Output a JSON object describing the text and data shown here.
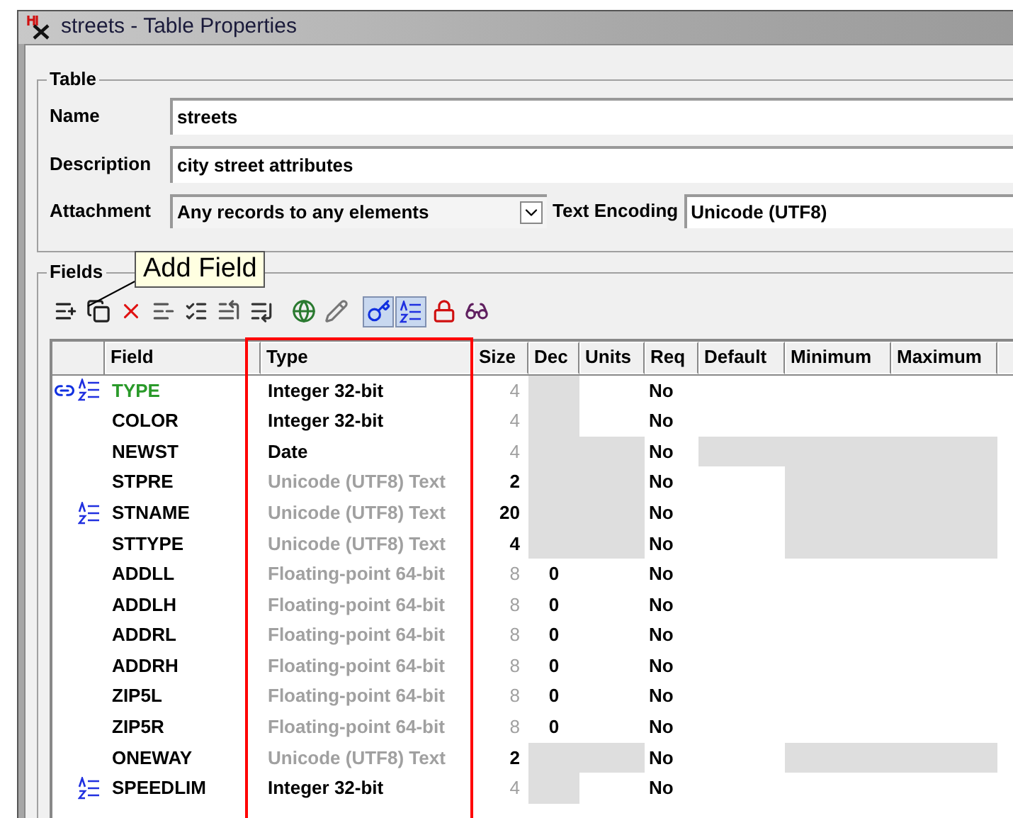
{
  "window": {
    "title": "streets - Table Properties"
  },
  "table_group": {
    "label": "Table",
    "name_label": "Name",
    "name": "streets",
    "description_label": "Description",
    "description": "city street attributes",
    "attachment_label": "Attachment",
    "attachment": "Any records to any elements",
    "encoding_label": "Text Encoding",
    "encoding": "Unicode (UTF8)"
  },
  "fields_group": {
    "label": "Fields",
    "tooltip": "Add Field",
    "toolbar": {
      "show_keys": true,
      "show_indexes": true
    },
    "columns": [
      "Field",
      "Type",
      "Size",
      "Dec",
      "Units",
      "Req",
      "Default",
      "Minimum",
      "Maximum"
    ],
    "rows": [
      {
        "field": "TYPE",
        "primary": true,
        "key": true,
        "indexed": true,
        "type": "Integer 32-bit",
        "type_dimmed": false,
        "size": "4",
        "size_dimmed": true,
        "dec_disabled": true,
        "units_disabled": false,
        "req": "No",
        "default_disabled": false,
        "limits_disabled": false
      },
      {
        "field": "COLOR",
        "primary": false,
        "key": false,
        "indexed": false,
        "type": "Integer 32-bit",
        "type_dimmed": false,
        "size": "4",
        "size_dimmed": true,
        "dec_disabled": true,
        "units_disabled": false,
        "req": "No",
        "default_disabled": false,
        "limits_disabled": false
      },
      {
        "field": "NEWST",
        "primary": false,
        "key": false,
        "indexed": false,
        "type": "Date",
        "type_dimmed": false,
        "size": "4",
        "size_dimmed": true,
        "dec_disabled": true,
        "units_disabled": true,
        "req": "No",
        "default_disabled": true,
        "limits_disabled": true
      },
      {
        "field": "STPRE",
        "primary": false,
        "key": false,
        "indexed": false,
        "type": "Unicode (UTF8) Text",
        "type_dimmed": true,
        "size": "2",
        "size_dimmed": false,
        "dec_disabled": true,
        "units_disabled": true,
        "req": "No",
        "default_disabled": false,
        "limits_disabled": true
      },
      {
        "field": "STNAME",
        "primary": false,
        "key": false,
        "indexed": true,
        "type": "Unicode (UTF8) Text",
        "type_dimmed": true,
        "size": "20",
        "size_dimmed": false,
        "dec_disabled": true,
        "units_disabled": true,
        "req": "No",
        "default_disabled": false,
        "limits_disabled": true
      },
      {
        "field": "STTYPE",
        "primary": false,
        "key": false,
        "indexed": false,
        "type": "Unicode (UTF8) Text",
        "type_dimmed": true,
        "size": "4",
        "size_dimmed": false,
        "dec_disabled": true,
        "units_disabled": true,
        "req": "No",
        "default_disabled": false,
        "limits_disabled": true
      },
      {
        "field": "ADDLL",
        "primary": false,
        "key": false,
        "indexed": false,
        "type": "Floating-point 64-bit",
        "type_dimmed": true,
        "size": "8",
        "size_dimmed": true,
        "dec": "0",
        "dec_disabled": false,
        "units_disabled": false,
        "req": "No",
        "default_disabled": false,
        "limits_disabled": false
      },
      {
        "field": "ADDLH",
        "primary": false,
        "key": false,
        "indexed": false,
        "type": "Floating-point 64-bit",
        "type_dimmed": true,
        "size": "8",
        "size_dimmed": true,
        "dec": "0",
        "dec_disabled": false,
        "units_disabled": false,
        "req": "No",
        "default_disabled": false,
        "limits_disabled": false
      },
      {
        "field": "ADDRL",
        "primary": false,
        "key": false,
        "indexed": false,
        "type": "Floating-point 64-bit",
        "type_dimmed": true,
        "size": "8",
        "size_dimmed": true,
        "dec": "0",
        "dec_disabled": false,
        "units_disabled": false,
        "req": "No",
        "default_disabled": false,
        "limits_disabled": false
      },
      {
        "field": "ADDRH",
        "primary": false,
        "key": false,
        "indexed": false,
        "type": "Floating-point 64-bit",
        "type_dimmed": true,
        "size": "8",
        "size_dimmed": true,
        "dec": "0",
        "dec_disabled": false,
        "units_disabled": false,
        "req": "No",
        "default_disabled": false,
        "limits_disabled": false
      },
      {
        "field": "ZIP5L",
        "primary": false,
        "key": false,
        "indexed": false,
        "type": "Floating-point 64-bit",
        "type_dimmed": true,
        "size": "8",
        "size_dimmed": true,
        "dec": "0",
        "dec_disabled": false,
        "units_disabled": false,
        "req": "No",
        "default_disabled": false,
        "limits_disabled": false
      },
      {
        "field": "ZIP5R",
        "primary": false,
        "key": false,
        "indexed": false,
        "type": "Floating-point 64-bit",
        "type_dimmed": true,
        "size": "8",
        "size_dimmed": true,
        "dec": "0",
        "dec_disabled": false,
        "units_disabled": false,
        "req": "No",
        "default_disabled": false,
        "limits_disabled": false
      },
      {
        "field": "ONEWAY",
        "primary": false,
        "key": false,
        "indexed": false,
        "type": "Unicode (UTF8) Text",
        "type_dimmed": true,
        "size": "2",
        "size_dimmed": false,
        "dec_disabled": true,
        "units_disabled": true,
        "req": "No",
        "default_disabled": false,
        "limits_disabled": true
      },
      {
        "field": "SPEEDLIM",
        "primary": false,
        "key": false,
        "indexed": true,
        "type": "Integer 32-bit",
        "type_dimmed": false,
        "size": "4",
        "size_dimmed": true,
        "dec_disabled": true,
        "units_disabled": false,
        "req": "No",
        "default_disabled": false,
        "limits_disabled": false
      }
    ]
  }
}
